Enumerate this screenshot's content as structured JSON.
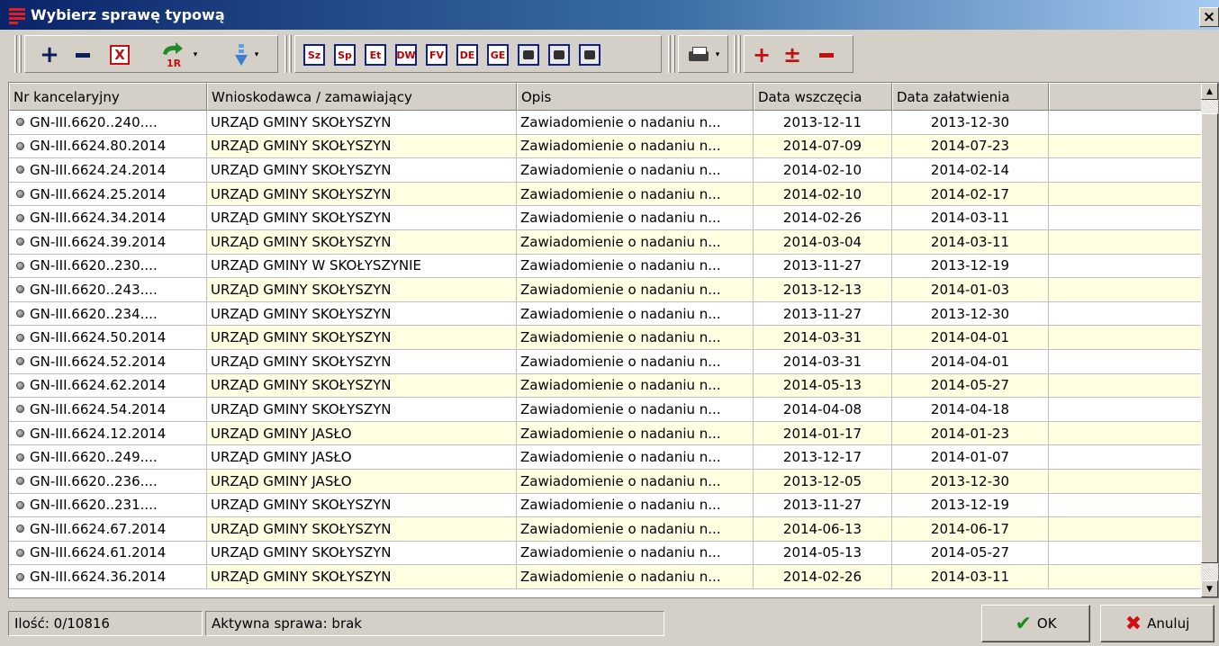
{
  "window": {
    "title": "Wybierz sprawę typową",
    "close_label": "×"
  },
  "toolbar": {
    "add": "+",
    "red_add": "+",
    "red_plusminus": "±",
    "delete_x": "X",
    "label_buttons": [
      "Sz",
      "Sp",
      "Et",
      "DW",
      "FV",
      "DE",
      "GE"
    ],
    "dropdown_arrow": "▾"
  },
  "table": {
    "columns": [
      "Nr kancelaryjny",
      "Wnioskodawca / zamawiający",
      "Opis",
      "Data wszczęcia",
      "Data załatwienia",
      ""
    ],
    "rows": [
      [
        "GN-III.6620..240....",
        "URZĄD GMINY SKOŁYSZYN",
        "Zawiadomienie o nadaniu n...",
        "2013-12-11",
        "2013-12-30"
      ],
      [
        "GN-III.6624.80.2014",
        "URZĄD GMINY SKOŁYSZYN",
        "Zawiadomienie o nadaniu n...",
        "2014-07-09",
        "2014-07-23"
      ],
      [
        "GN-III.6624.24.2014",
        "URZĄD GMINY SKOŁYSZYN",
        "Zawiadomienie o nadaniu n...",
        "2014-02-10",
        "2014-02-14"
      ],
      [
        "GN-III.6624.25.2014",
        "URZĄD GMINY SKOŁYSZYN",
        "Zawiadomienie o nadaniu n...",
        "2014-02-10",
        "2014-02-17"
      ],
      [
        "GN-III.6624.34.2014",
        "URZĄD GMINY SKOŁYSZYN",
        "Zawiadomienie o nadaniu n...",
        "2014-02-26",
        "2014-03-11"
      ],
      [
        "GN-III.6624.39.2014",
        "URZĄD GMINY SKOŁYSZYN",
        "Zawiadomienie o nadaniu n...",
        "2014-03-04",
        "2014-03-11"
      ],
      [
        "GN-III.6620..230....",
        "URZĄD GMINY W SKOŁYSZYNIE",
        "Zawiadomienie o nadaniu n...",
        "2013-11-27",
        "2013-12-19"
      ],
      [
        "GN-III.6620..243....",
        "URZĄD GMINY SKOŁYSZYN",
        "Zawiadomienie o nadaniu n...",
        "2013-12-13",
        "2014-01-03"
      ],
      [
        "GN-III.6620..234....",
        "URZĄD GMINY SKOŁYSZYN",
        "Zawiadomienie o nadaniu n...",
        "2013-11-27",
        "2013-12-30"
      ],
      [
        "GN-III.6624.50.2014",
        "URZĄD GMINY SKOŁYSZYN",
        "Zawiadomienie o nadaniu n...",
        "2014-03-31",
        "2014-04-01"
      ],
      [
        "GN-III.6624.52.2014",
        "URZĄD GMINY SKOŁYSZYN",
        "Zawiadomienie o nadaniu n...",
        "2014-03-31",
        "2014-04-01"
      ],
      [
        "GN-III.6624.62.2014",
        "URZĄD GMINY SKOŁYSZYN",
        "Zawiadomienie o nadaniu n...",
        "2014-05-13",
        "2014-05-27"
      ],
      [
        "GN-III.6624.54.2014",
        "URZĄD GMINY SKOŁYSZYN",
        "Zawiadomienie o nadaniu n...",
        "2014-04-08",
        "2014-04-18"
      ],
      [
        "GN-III.6624.12.2014",
        "URZĄD GMINY JASŁO",
        "Zawiadomienie o nadaniu n...",
        "2014-01-17",
        "2014-01-23"
      ],
      [
        "GN-III.6620..249....",
        "URZĄD GMINY JASŁO",
        "Zawiadomienie o nadaniu n...",
        "2013-12-17",
        "2014-01-07"
      ],
      [
        "GN-III.6620..236....",
        "URZĄD GMINY JASŁO",
        "Zawiadomienie o nadaniu n...",
        "2013-12-05",
        "2013-12-30"
      ],
      [
        "GN-III.6620..231....",
        "URZĄD GMINY SKOŁYSZYN",
        "Zawiadomienie o nadaniu n...",
        "2013-11-27",
        "2013-12-19"
      ],
      [
        "GN-III.6624.67.2014",
        "URZĄD GMINY SKOŁYSZYN",
        "Zawiadomienie o nadaniu n...",
        "2014-06-13",
        "2014-06-17"
      ],
      [
        "GN-III.6624.61.2014",
        "URZĄD GMINY SKOŁYSZYN",
        "Zawiadomienie o nadaniu n...",
        "2014-05-13",
        "2014-05-27"
      ],
      [
        "GN-III.6624.36.2014",
        "URZĄD GMINY SKOŁYSZYN",
        "Zawiadomienie o nadaniu n...",
        "2014-02-26",
        "2014-03-11"
      ]
    ]
  },
  "footer": {
    "count": "Ilość: 0/10816",
    "active_case": "Aktywna sprawa: brak",
    "ok_label": "OK",
    "cancel_label": "Anuluj"
  },
  "colors": {
    "title_start": "#0a246a",
    "title_end": "#a6caf0",
    "row_alt": "#ffffe1",
    "chrome": "#d4d0c8"
  }
}
